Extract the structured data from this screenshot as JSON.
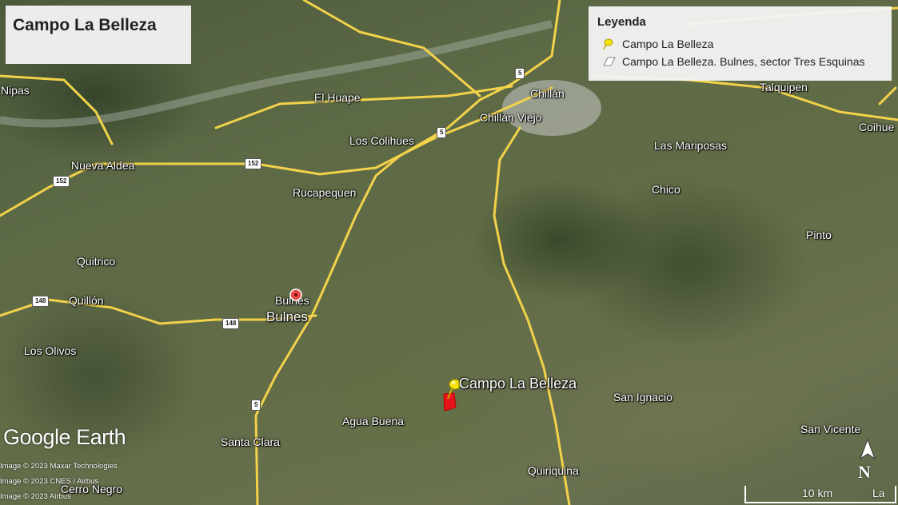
{
  "title": "Campo La Belleza",
  "legend": {
    "title": "Leyenda",
    "items": [
      {
        "label": "Campo La Belleza",
        "icon": "yellow-pushpin-icon"
      },
      {
        "label": "Campo La Belleza. Bulnes, sector Tres Esquinas",
        "icon": "polygon-outline-icon"
      }
    ]
  },
  "places": {
    "nipas": "Nipas",
    "el_huape": "El Huape",
    "chillan": "Chillán",
    "chillan_viejo": "Chillán Viejo",
    "talquipen": "Talquipen",
    "coihueco": "Coihue",
    "los_colihues": "Los Colihues",
    "nueva_aldea": "Nueva Aldea",
    "las_mariposas": "Las Mariposas",
    "rucapequen": "Rucapequen",
    "chico": "Chico",
    "pinto": "Pinto",
    "quitrico": "Quitrico",
    "quillon": "Quillón",
    "bulnes_small": "Bulnes",
    "bulnes_big": "Bulnes",
    "los_olivos": "Los Olivos",
    "campo_la_belleza": "Campo La Belleza",
    "san_ignacio": "San Ignacio",
    "agua_buena": "Agua Buena",
    "santa_clara": "Santa Clara",
    "san_vicente": "San Vicente",
    "quiriquina": "Quiriquina",
    "cerro_negro": "Cerro Negro"
  },
  "route_shields": {
    "r5_north": "5",
    "r5_mid": "5",
    "r5_south": "5",
    "r152_east": "152",
    "r152_west": "152",
    "r148_west": "148",
    "r148_east": "148"
  },
  "branding": {
    "logo": "Google Earth",
    "credits": [
      "Image © 2023 Maxar Technologies",
      "Image © 2023 CNES / Airbus",
      "Image © 2023 Airbus"
    ]
  },
  "scale": {
    "label": "10 km",
    "extra": "La"
  },
  "north_label": "N",
  "colors": {
    "road": "#f2d24a",
    "marker_yellow": "#f5e20a",
    "polygon_red": "#e8141b",
    "panel_bg": "#f4f4f4"
  }
}
